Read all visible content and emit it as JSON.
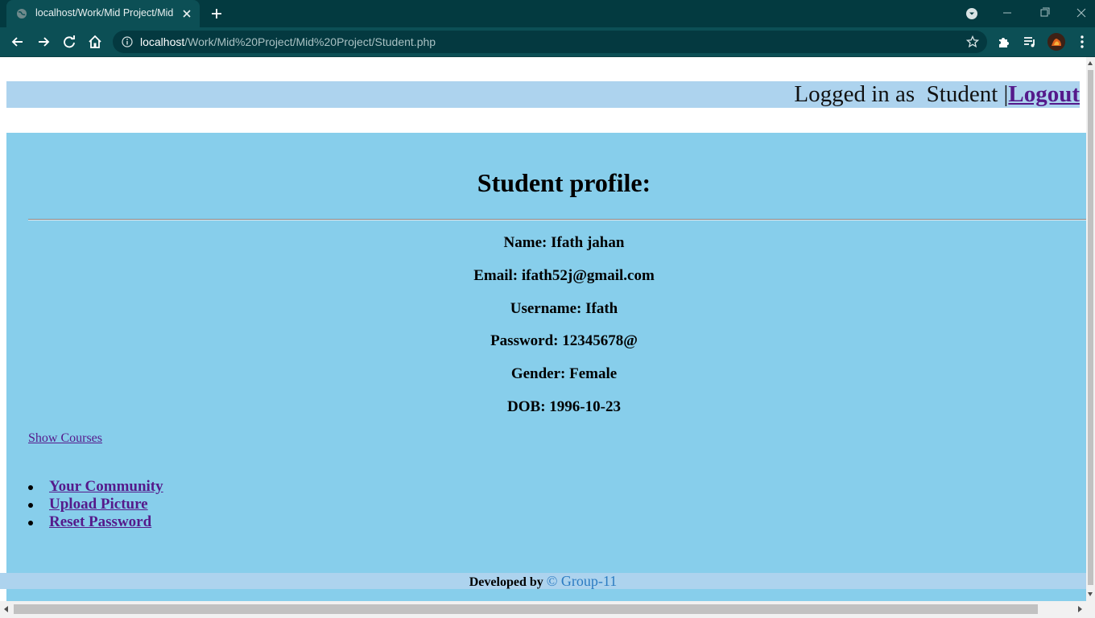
{
  "browser": {
    "tab_title": "localhost/Work/Mid Project/Mid",
    "url_host": "localhost",
    "url_path": "/Work/Mid%20Project/Mid%20Project/Student.php"
  },
  "header": {
    "logged_in_text": "Logged in as  Student |",
    "logout_label": "Logout"
  },
  "profile": {
    "title": "Student profile:",
    "name": "Name: Ifath jahan",
    "email": "Email: ifath52j@gmail.com",
    "username": "Username: Ifath",
    "password": "Password: 12345678@",
    "gender": "Gender: Female",
    "dob": "DOB: 1996-10-23"
  },
  "links": {
    "show_courses": "Show Courses",
    "menu": [
      "Your Community",
      "Upload Picture",
      "Reset Password"
    ]
  },
  "footer": {
    "developed_by": "Developed by",
    "group": "© Group-11"
  },
  "colors": {
    "chrome_bg": "#033a40",
    "toolbar_bg": "#0c4f55",
    "login_bar": "#add3ee",
    "main_bg": "#87ceeb",
    "link_visited": "#551a8b",
    "footer_group": "#2b7bc2"
  },
  "icons": [
    "globe-icon",
    "close-icon",
    "plus-icon",
    "chevron-down-icon",
    "minimize-icon",
    "maximize-icon",
    "window-close-icon",
    "back-arrow-icon",
    "forward-arrow-icon",
    "reload-icon",
    "home-icon",
    "info-icon",
    "star-icon",
    "puzzle-icon",
    "media-queue-icon",
    "kebab-menu-icon"
  ]
}
